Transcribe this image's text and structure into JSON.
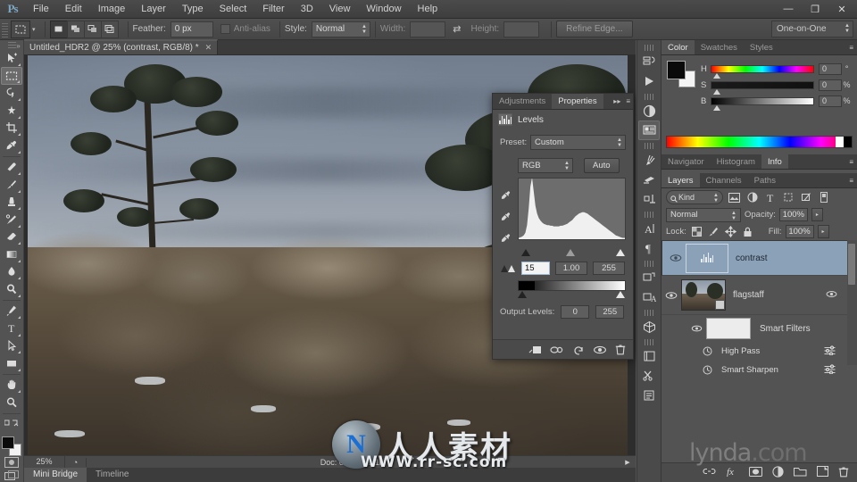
{
  "app": {
    "logo": "Ps",
    "menus": [
      "File",
      "Edit",
      "Image",
      "Layer",
      "Type",
      "Select",
      "Filter",
      "3D",
      "View",
      "Window",
      "Help"
    ],
    "window_controls": {
      "minimize": "—",
      "restore": "❐",
      "close": "✕"
    }
  },
  "options_bar": {
    "tool_icon": "rectangular-marquee",
    "marquee_modes": [
      "new-selection",
      "add-to-selection",
      "subtract-from-selection",
      "intersect-with-selection"
    ],
    "feather_label": "Feather:",
    "feather_value": "0 px",
    "antialias_label": "Anti-alias",
    "antialias_checked": false,
    "style_label": "Style:",
    "style_value": "Normal",
    "width_label": "Width:",
    "width_value": "",
    "height_label": "Height:",
    "height_value": "",
    "swap_icon": "swap-width-height-icon",
    "refine_edge_label": "Refine Edge...",
    "workspace": "One-on-One"
  },
  "toolbar": {
    "tools": [
      {
        "name": "move-tool",
        "active": false
      },
      {
        "name": "rectangular-marquee-tool",
        "active": true
      },
      {
        "name": "lasso-tool",
        "active": false
      },
      {
        "name": "quick-selection-tool",
        "active": false
      },
      {
        "name": "crop-tool",
        "active": false
      },
      {
        "name": "eyedropper-tool",
        "active": false
      },
      {
        "name": "spot-healing-brush-tool",
        "active": false
      },
      {
        "name": "brush-tool",
        "active": false
      },
      {
        "name": "clone-stamp-tool",
        "active": false
      },
      {
        "name": "history-brush-tool",
        "active": false
      },
      {
        "name": "eraser-tool",
        "active": false
      },
      {
        "name": "gradient-tool",
        "active": false
      },
      {
        "name": "blur-tool",
        "active": false
      },
      {
        "name": "dodge-tool",
        "active": false
      },
      {
        "name": "pen-tool",
        "active": false
      },
      {
        "name": "horizontal-type-tool",
        "active": false
      },
      {
        "name": "path-selection-tool",
        "active": false
      },
      {
        "name": "rectangle-tool",
        "active": false
      },
      {
        "name": "hand-tool",
        "active": false
      },
      {
        "name": "zoom-tool",
        "active": false
      }
    ],
    "foreground_color": "#0b0b0b",
    "background_color": "#f2f2f2",
    "quick_mask_name": "quick-mask-mode",
    "screen_mode_name": "screen-mode"
  },
  "document": {
    "tab_title": "Untitled_HDR2 @ 25% (contrast, RGB/8) *",
    "close_glyph": "✕"
  },
  "status_bar": {
    "zoom": "25%",
    "doc_info": "Doc: 62.1M/62.1M",
    "arrow": "▶"
  },
  "bottom_tabs": [
    {
      "label": "Mini Bridge",
      "active": true
    },
    {
      "label": "Timeline",
      "active": false
    }
  ],
  "properties_panel": {
    "tabs": [
      {
        "label": "Adjustments",
        "active": false
      },
      {
        "label": "Properties",
        "active": true
      }
    ],
    "collapse_glyph": "▸▸",
    "menu_glyph": "≡",
    "title": "Levels",
    "title_icon": "levels-icon",
    "preset_label": "Preset:",
    "preset_value": "Custom",
    "channel_value": "RGB",
    "auto_label": "Auto",
    "eyedroppers": [
      "set-black-point-eyedropper",
      "set-gray-point-eyedropper",
      "set-white-point-eyedropper"
    ],
    "input_black": "15",
    "input_gamma": "1.00",
    "input_white": "255",
    "output_levels_label": "Output Levels:",
    "output_black": "0",
    "output_white": "255",
    "footer_icons": [
      "clip-to-layer-icon",
      "view-previous-state-icon",
      "reset-icon",
      "toggle-visibility-icon",
      "delete-icon"
    ],
    "histogram": [
      2,
      3,
      4,
      6,
      10,
      22,
      48,
      82,
      96,
      74,
      52,
      40,
      33,
      29,
      26,
      24,
      23,
      22,
      22,
      21,
      21,
      20,
      20,
      20,
      20,
      21,
      21,
      22,
      23,
      24,
      26,
      28,
      30,
      33,
      36,
      38,
      40,
      41,
      42,
      42,
      41,
      40,
      38,
      36,
      34,
      32,
      30,
      28,
      26,
      24,
      22,
      20,
      18,
      16,
      14,
      12,
      10,
      8,
      6,
      5,
      4,
      3,
      2,
      2,
      2,
      58
    ]
  },
  "icon_dock": [
    {
      "name": "history-panel-icon"
    },
    {
      "name": "actions-panel-icon"
    },
    {
      "name": "adjustments-panel-icon"
    },
    {
      "name": "properties-panel-icon",
      "active": true
    },
    {
      "name": "brush-panel-icon"
    },
    {
      "name": "brush-presets-panel-icon"
    },
    {
      "name": "clone-source-panel-icon"
    },
    {
      "name": "character-panel-icon"
    },
    {
      "name": "paragraph-panel-icon"
    },
    {
      "name": "character-styles-panel-icon"
    },
    {
      "name": "paragraph-styles-panel-icon"
    },
    {
      "name": "3d-panel-icon"
    },
    {
      "name": "layer-comps-panel-icon"
    },
    {
      "name": "tool-presets-panel-icon"
    },
    {
      "name": "notes-panel-icon"
    }
  ],
  "color_panel": {
    "tabs": [
      {
        "label": "Color",
        "active": true
      },
      {
        "label": "Swatches",
        "active": false
      },
      {
        "label": "Styles",
        "active": false
      }
    ],
    "foreground_color": "#0a0a0a",
    "background_color": "#f4f4f4",
    "sliders": [
      {
        "channel": "H",
        "value": "0",
        "unit": "°"
      },
      {
        "channel": "S",
        "value": "0",
        "unit": "%"
      },
      {
        "channel": "B",
        "value": "0",
        "unit": "%"
      }
    ]
  },
  "navigator_group": {
    "tabs": [
      {
        "label": "Navigator",
        "active": false
      },
      {
        "label": "Histogram",
        "active": false
      },
      {
        "label": "Info",
        "active": true
      }
    ]
  },
  "layers_panel": {
    "tabs": [
      {
        "label": "Layers",
        "active": true
      },
      {
        "label": "Channels",
        "active": false
      },
      {
        "label": "Paths",
        "active": false
      }
    ],
    "filter_kind_label": "Kind",
    "filter_icons": [
      "filter-pixel-icon",
      "filter-adjustment-icon",
      "filter-type-icon",
      "filter-shape-icon",
      "filter-smartobject-icon",
      "filter-toggle-icon"
    ],
    "blend_mode": "Normal",
    "opacity_label": "Opacity:",
    "opacity_value": "100%",
    "lock_label": "Lock:",
    "lock_icons": [
      "lock-transparent-pixels-icon",
      "lock-image-pixels-icon",
      "lock-position-icon",
      "lock-all-icon"
    ],
    "fill_label": "Fill:",
    "fill_value": "100%",
    "layers": [
      {
        "name": "contrast",
        "type": "adjustment",
        "selected": true,
        "visible": true
      },
      {
        "name": "flagstaff",
        "type": "smart-object",
        "selected": false,
        "visible": true
      }
    ],
    "smart_filters_label": "Smart Filters",
    "smart_filters": [
      {
        "label": "High Pass",
        "visible": true
      },
      {
        "label": "Smart Sharpen",
        "visible": true
      }
    ],
    "footer_icons": [
      "link-layers-icon",
      "add-layer-style-icon",
      "add-layer-mask-icon",
      "new-adjustment-layer-icon",
      "new-group-icon",
      "new-layer-icon",
      "delete-layer-icon"
    ]
  },
  "watermarks": {
    "center_logo": "N",
    "center_text": "人人素材",
    "url": "WWW.rr-sc.com",
    "brand": "lynda",
    "brand_suffix": ".com"
  }
}
